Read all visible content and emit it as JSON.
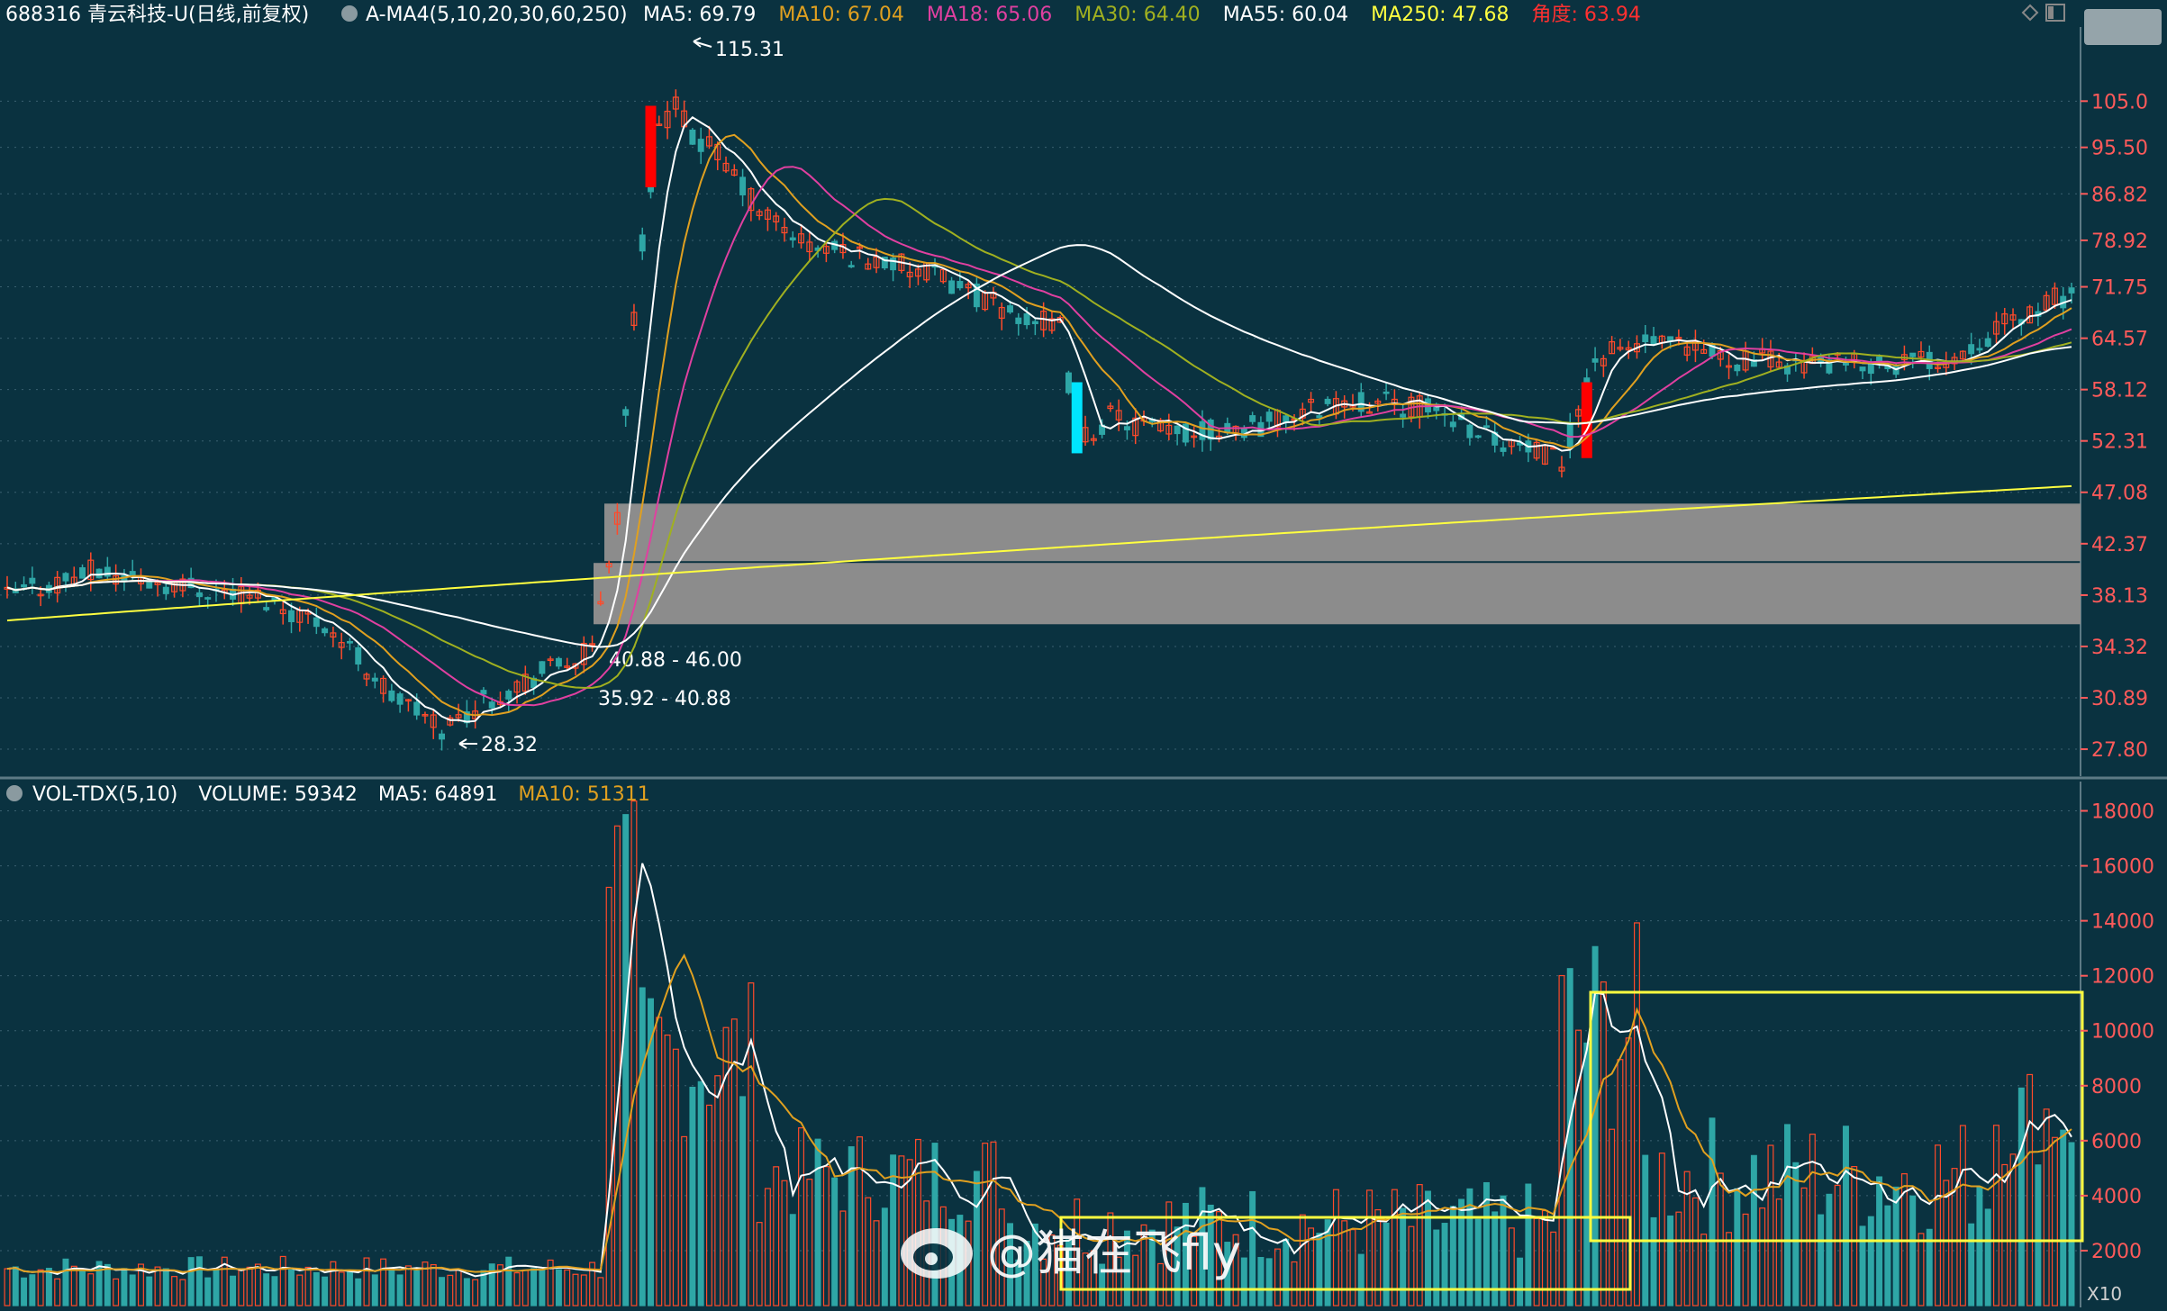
{
  "header": {
    "stock": "688316 青云科技-U(日线,前复权)",
    "indicator": "A-MA4(5,10,20,30,60,250)",
    "items": [
      {
        "label": "MA5: 69.79",
        "color": "#ffffff"
      },
      {
        "label": "MA10: 67.04",
        "color": "#e0a020"
      },
      {
        "label": "MA18: 65.06",
        "color": "#e040a0"
      },
      {
        "label": "MA30: 64.40",
        "color": "#a0b020"
      },
      {
        "label": "MA55: 60.04",
        "color": "#ffffff"
      },
      {
        "label": "MA250: 47.68",
        "color": "#ffff40"
      },
      {
        "label": "角度: 63.94",
        "color": "#ff3030"
      }
    ]
  },
  "vol_header": {
    "indicator": "VOL-TDX(5,10)",
    "volume": "VOLUME: 59342",
    "ma5": "MA5: 64891",
    "ma10": "MA10: 51311",
    "ma10_color": "#e0a020"
  },
  "annotations": {
    "high": "115.31",
    "low": "28.32",
    "band_upper": "40.88 - 46.00",
    "band_lower": "35.92 - 40.88"
  },
  "multiplier": "X10",
  "watermark": "@猫在飞fly",
  "colors": {
    "background": "#0a3240",
    "up": "#ff4a2a",
    "down": "#2ea6a6",
    "axis_text": "#ff5a5a",
    "band": "#8c8c8c",
    "box": "#ffff40",
    "ma5": "#ffffff",
    "ma10": "#e0a020",
    "ma18": "#e040a0",
    "ma30": "#a0b020",
    "ma55": "#ffffff",
    "ma250": "#ffff40"
  },
  "chart_data": [
    {
      "type": "candlestick",
      "title": "688316 青云科技-U(日线,前复权)",
      "y_ticks": [
        "105.0",
        "95.50",
        "86.82",
        "78.92",
        "71.75",
        "64.57",
        "58.12",
        "52.31",
        "47.08",
        "42.37",
        "38.13",
        "34.32",
        "30.89",
        "27.80"
      ],
      "y_scale": "log",
      "ylim": [
        26.5,
        120
      ],
      "bands": [
        {
          "label": "40.88 - 46.00",
          "low": 40.88,
          "high": 46.0
        },
        {
          "label": "35.92 - 40.88",
          "low": 35.92,
          "high": 40.88
        }
      ],
      "series": [
        {
          "name": "MA5",
          "value": 69.79
        },
        {
          "name": "MA10",
          "value": 67.04
        },
        {
          "name": "MA18",
          "value": 65.06
        },
        {
          "name": "MA30",
          "value": 64.4
        },
        {
          "name": "MA55",
          "value": 60.04
        },
        {
          "name": "MA250",
          "value": 47.68
        }
      ],
      "high_annotation": 115.31,
      "low_annotation": 28.32
    },
    {
      "type": "bar",
      "title": "VOL-TDX(5,10)",
      "y_ticks": [
        "18000",
        "16000",
        "14000",
        "12000",
        "10000",
        "8000",
        "6000",
        "4000",
        "2000"
      ],
      "ylim": [
        0,
        19000
      ],
      "multiplier": "X10",
      "volume": 59342,
      "ma5": 64891,
      "ma10": 51311
    }
  ]
}
